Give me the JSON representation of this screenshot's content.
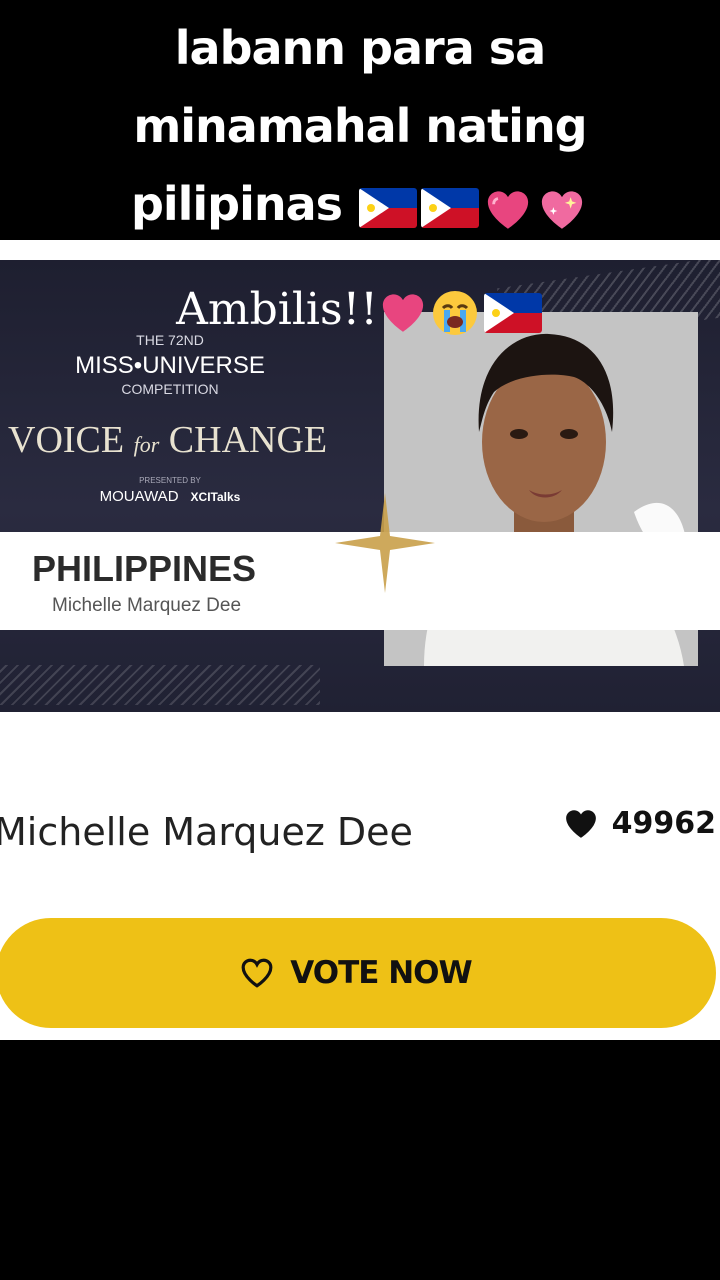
{
  "caption": {
    "line1": "labann para sa",
    "line2": "minamahal nating",
    "line3_text": "pilipinas"
  },
  "banner": {
    "overlay_text": "Ambilis!!",
    "event_top": "THE 72ND",
    "event_title": "MISS•UNIVERSE",
    "event_sub": "COMPETITION",
    "voice_1": "VOICE",
    "voice_for": "for",
    "voice_2": "CHANGE",
    "presented_by": "PRESENTED BY",
    "sponsor_1": "MOUAWAD",
    "sponsor_2": "XCITalks",
    "country": "PHILIPPINES",
    "contestant": "Michelle  Marquez Dee"
  },
  "card": {
    "name": "Michelle Marquez Dee",
    "likes": "49962",
    "vote_label": "VOTE NOW"
  },
  "icons": {
    "flag": "philippine-flag-icon",
    "heart": "heart-icon",
    "sparkling_heart": "sparkling-heart-icon",
    "crying": "crying-face-icon"
  },
  "colors": {
    "vote_button": "#eec116",
    "banner_bg": "#1e1f30",
    "flag_blue": "#0038a8",
    "flag_red": "#ce1126",
    "emoji_pink": "#e8457f"
  }
}
